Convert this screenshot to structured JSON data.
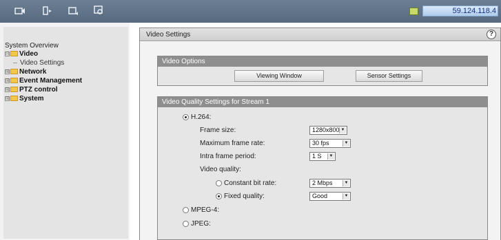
{
  "topbar": {
    "icons": [
      "camera-icon",
      "record-icon",
      "snapshot-icon",
      "zoom-icon"
    ],
    "ip_address": "59.124.118.4"
  },
  "sidebar": {
    "system_overview": "System Overview",
    "items": [
      {
        "label": "Video",
        "toggle": "⊟",
        "expanded": true
      },
      {
        "label": "Network",
        "toggle": "⊞",
        "expanded": false
      },
      {
        "label": "Event Management",
        "toggle": "⊞",
        "expanded": false
      },
      {
        "label": "PTZ control",
        "toggle": "⊞",
        "expanded": false
      },
      {
        "label": "System",
        "toggle": "⊞",
        "expanded": false
      }
    ],
    "video_children": [
      "Video Settings"
    ]
  },
  "main": {
    "title": "Video Settings",
    "help": "?",
    "video_options": {
      "header": "Video Options",
      "viewing_window_btn": "Viewing Window",
      "sensor_settings_btn": "Sensor Settings"
    },
    "quality": {
      "header": "Video Quality Settings for Stream 1",
      "h264_label": "H.264:",
      "frame_size_label": "Frame size:",
      "frame_size_value": "1280x800",
      "max_frame_rate_label": "Maximum frame rate:",
      "max_frame_rate_value": "30 fps",
      "intra_period_label": "Intra frame period:",
      "intra_period_value": "1 S",
      "video_quality_label": "Video quality:",
      "cbr_label": "Constant bit rate:",
      "cbr_value": "2 Mbps",
      "fixed_quality_label": "Fixed quality:",
      "fixed_quality_value": "Good",
      "mpeg4_label": "MPEG-4:",
      "jpeg_label": "JPEG:"
    }
  }
}
